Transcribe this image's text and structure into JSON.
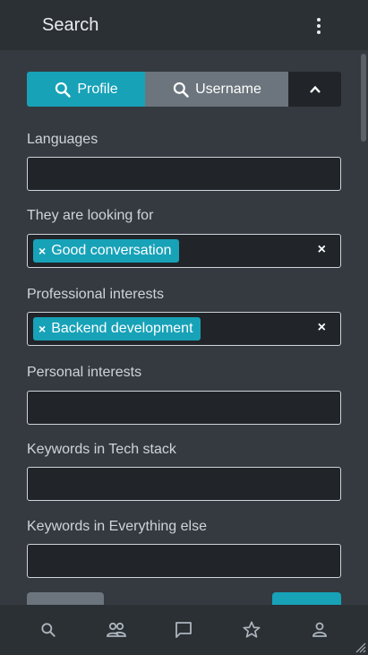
{
  "header": {
    "title": "Search",
    "menu_icon": "more-vertical-icon"
  },
  "search_mode": {
    "profile_label": "Profile",
    "username_label": "Username",
    "selected": "Profile",
    "collapse_icon": "chevron-up-icon"
  },
  "filters": {
    "languages": {
      "label": "Languages",
      "value": ""
    },
    "looking_for": {
      "label": "They are looking for",
      "tags": [
        "Good conversation"
      ],
      "clear": "×"
    },
    "professional": {
      "label": "Professional interests",
      "tags": [
        "Backend development"
      ],
      "clear": "×"
    },
    "personal": {
      "label": "Personal interests",
      "value": ""
    },
    "tech_stack": {
      "label": "Keywords in Tech stack",
      "value": ""
    },
    "everything_else": {
      "label": "Keywords in Everything else",
      "value": ""
    }
  },
  "tag_remove": "×",
  "bottom_nav": [
    {
      "icon": "search-icon"
    },
    {
      "icon": "people-icon"
    },
    {
      "icon": "chat-icon"
    },
    {
      "icon": "star-icon"
    },
    {
      "icon": "person-icon"
    }
  ],
  "colors": {
    "accent": "#17a2b8",
    "secondary": "#6c757d",
    "background": "#343a40",
    "bar": "#2b3035"
  }
}
